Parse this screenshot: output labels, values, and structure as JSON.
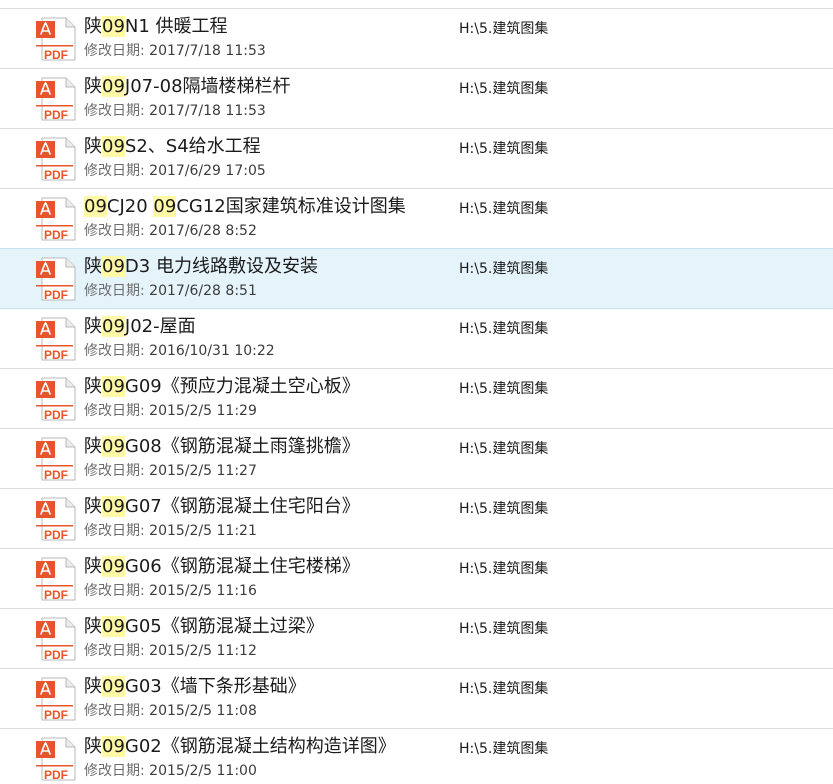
{
  "colors": {
    "highlight": "#fff8a6",
    "selected_row": "#e5f3fb",
    "pdf_orange": "#e8542b"
  },
  "icon": {
    "name": "pdf-file-icon",
    "label": "PDF"
  },
  "date_label": "修改日期:",
  "selected_index": 4,
  "files": [
    {
      "title": [
        {
          "t": "陕"
        },
        {
          "t": "09",
          "hl": true
        },
        {
          "t": "N1 供暖工程"
        }
      ],
      "date": "2017/7/18 11:53",
      "path": "H:\\5.建筑图集"
    },
    {
      "title": [
        {
          "t": "陕"
        },
        {
          "t": "09",
          "hl": true
        },
        {
          "t": "J07-08隔墙楼梯栏杆"
        }
      ],
      "date": "2017/7/18 11:53",
      "path": "H:\\5.建筑图集"
    },
    {
      "title": [
        {
          "t": "陕"
        },
        {
          "t": "09",
          "hl": true
        },
        {
          "t": "S2、S4给水工程"
        }
      ],
      "date": "2017/6/29 17:05",
      "path": "H:\\5.建筑图集"
    },
    {
      "title": [
        {
          "t": "09",
          "hl": true
        },
        {
          "t": "CJ20 "
        },
        {
          "t": "09",
          "hl": true
        },
        {
          "t": "CG12国家建筑标准设计图集"
        }
      ],
      "date": "2017/6/28 8:52",
      "path": "H:\\5.建筑图集"
    },
    {
      "title": [
        {
          "t": "陕"
        },
        {
          "t": "09",
          "hl": true
        },
        {
          "t": "D3 电力线路敷设及安装"
        }
      ],
      "date": "2017/6/28 8:51",
      "path": "H:\\5.建筑图集"
    },
    {
      "title": [
        {
          "t": "陕"
        },
        {
          "t": "09",
          "hl": true
        },
        {
          "t": "J02-屋面"
        }
      ],
      "date": "2016/10/31 10:22",
      "path": "H:\\5.建筑图集"
    },
    {
      "title": [
        {
          "t": "陕"
        },
        {
          "t": "09",
          "hl": true
        },
        {
          "t": "G09《预应力混凝土空心板》"
        }
      ],
      "date": "2015/2/5 11:29",
      "path": "H:\\5.建筑图集"
    },
    {
      "title": [
        {
          "t": "陕"
        },
        {
          "t": "09",
          "hl": true
        },
        {
          "t": "G08《钢筋混凝土雨篷挑檐》"
        }
      ],
      "date": "2015/2/5 11:27",
      "path": "H:\\5.建筑图集"
    },
    {
      "title": [
        {
          "t": "陕"
        },
        {
          "t": "09",
          "hl": true
        },
        {
          "t": "G07《钢筋混凝土住宅阳台》"
        }
      ],
      "date": "2015/2/5 11:21",
      "path": "H:\\5.建筑图集"
    },
    {
      "title": [
        {
          "t": "陕"
        },
        {
          "t": "09",
          "hl": true
        },
        {
          "t": "G06《钢筋混凝土住宅楼梯》"
        }
      ],
      "date": "2015/2/5 11:16",
      "path": "H:\\5.建筑图集"
    },
    {
      "title": [
        {
          "t": "陕"
        },
        {
          "t": "09",
          "hl": true
        },
        {
          "t": "G05《钢筋混凝土过梁》"
        }
      ],
      "date": "2015/2/5 11:12",
      "path": "H:\\5.建筑图集"
    },
    {
      "title": [
        {
          "t": "陕"
        },
        {
          "t": "09",
          "hl": true
        },
        {
          "t": "G03《墙下条形基础》"
        }
      ],
      "date": "2015/2/5 11:08",
      "path": "H:\\5.建筑图集"
    },
    {
      "title": [
        {
          "t": "陕"
        },
        {
          "t": "09",
          "hl": true
        },
        {
          "t": "G02《钢筋混凝土结构构造详图》"
        }
      ],
      "date": "2015/2/5 11:00",
      "path": "H:\\5.建筑图集"
    }
  ]
}
